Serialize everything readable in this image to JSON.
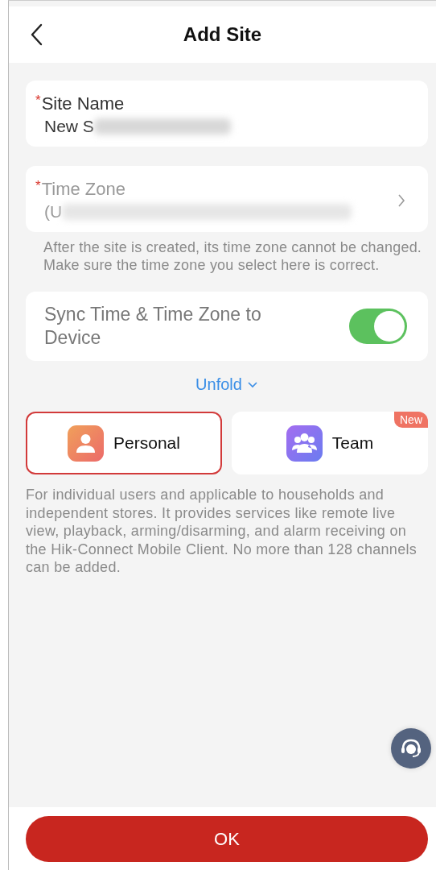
{
  "header": {
    "title": "Add Site"
  },
  "fields": [
    {
      "kind": "text",
      "mark": "*",
      "label": "Site Name",
      "value": "New S",
      "blurred": true
    },
    {
      "kind": "picker",
      "mark": "*",
      "label": "Time Zone",
      "value": "(U",
      "blurred": true
    }
  ],
  "time_zone_hint": "After the site is created, its time zone cannot be changed. Make sure the time zone you select here is correct.",
  "sync": {
    "label": "Sync Time & Time Zone to Device",
    "on": true
  },
  "unfold": "Unfold",
  "site_types": [
    {
      "kind": "personal",
      "label": "Personal",
      "selected": true
    },
    {
      "kind": "team",
      "label": "Team",
      "selected": false,
      "badge": "New"
    }
  ],
  "description": "For individual users and applicable to households and independent stores. It provides services like remote live view, playback, arming/disarming, and alarm receiving on the Hik-Connect Mobile Client. No more than 128 channels can be added.",
  "ok_button": "OK"
}
